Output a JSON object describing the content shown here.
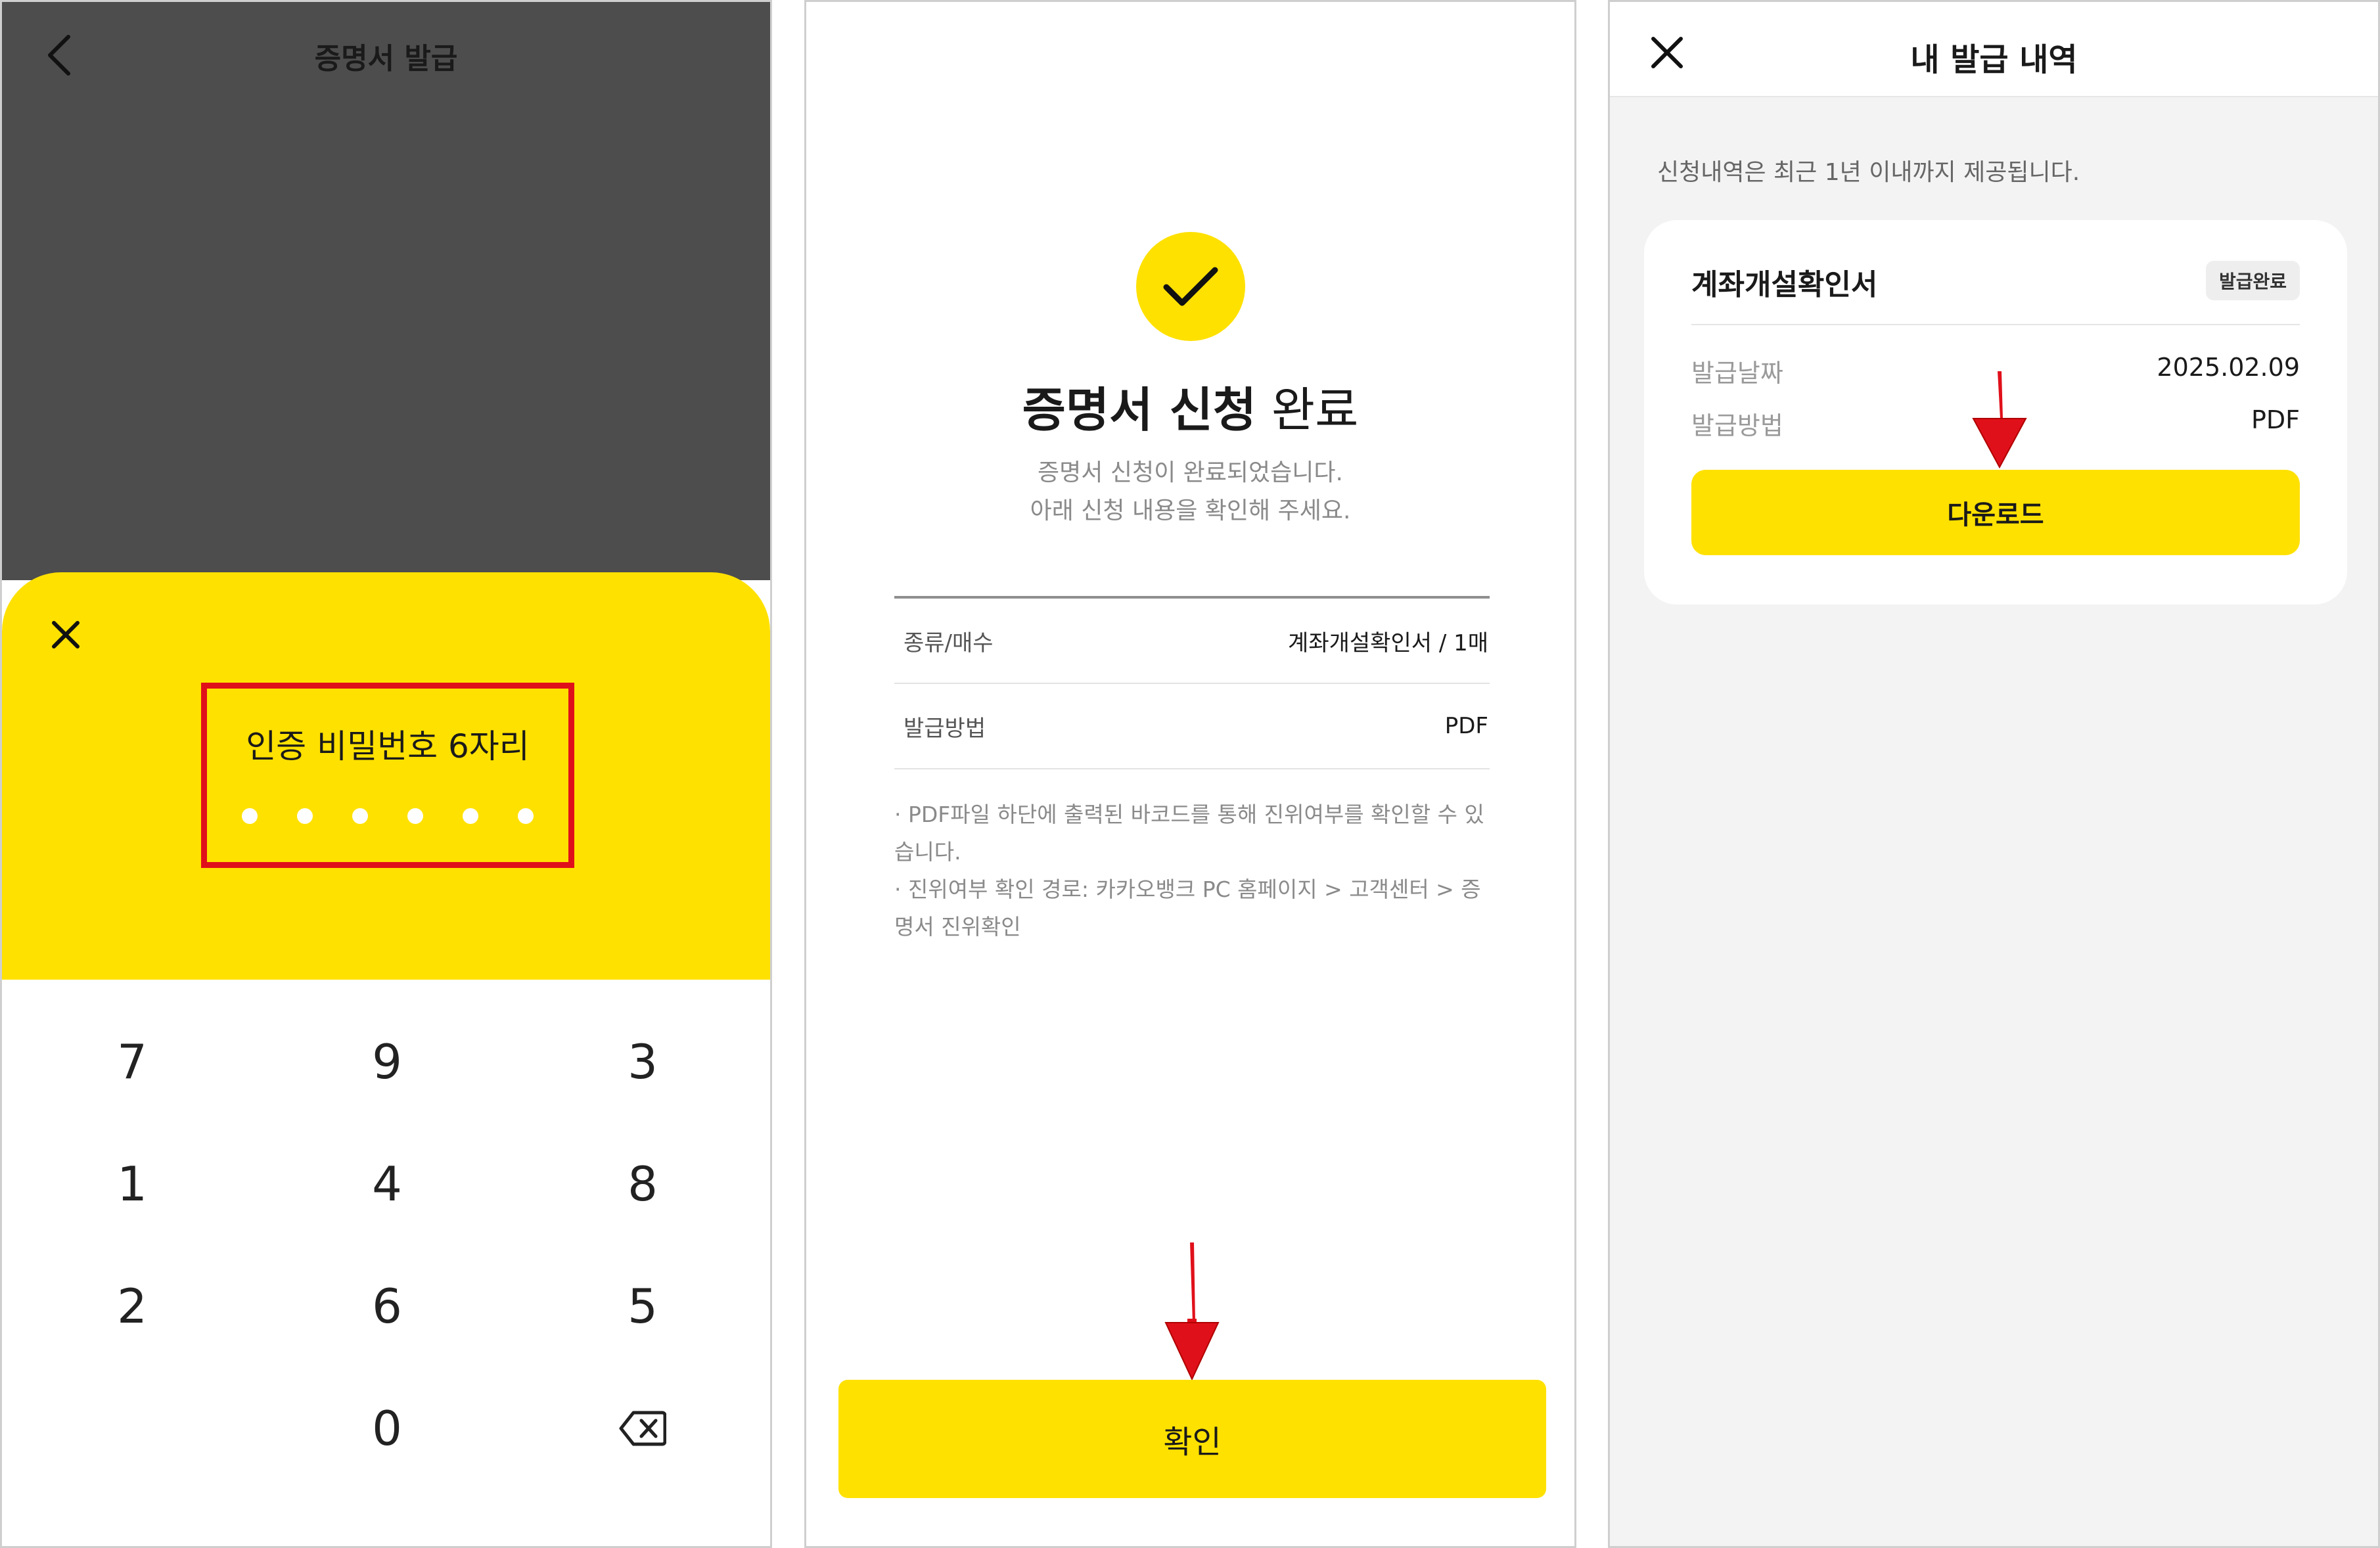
{
  "colors": {
    "accent": "#ffe100",
    "highlight": "#e0101a",
    "dim_overlay": "#4d4d4d"
  },
  "panel1": {
    "title": "증명서 발급",
    "pin": {
      "label": "인증 비밀번호 6자리",
      "dot_count": 6
    },
    "keypad": {
      "rows": [
        [
          "7",
          "9",
          "3"
        ],
        [
          "1",
          "4",
          "8"
        ],
        [
          "2",
          "6",
          "5"
        ],
        [
          "",
          "0",
          "backspace-icon"
        ]
      ]
    },
    "icons": {
      "back": "chevron-left-icon",
      "close": "close-icon",
      "backspace": "backspace-icon"
    }
  },
  "panel2": {
    "title_bold": "증명서 신청",
    "title_light": "완료",
    "desc_line1": "증명서 신청이 완료되었습니다.",
    "desc_line2": "아래 신청 내용을 확인해 주세요.",
    "rows": [
      {
        "label": "종류/매수",
        "value": "계좌개설확인서 / 1매"
      },
      {
        "label": "발급방법",
        "value": "PDF"
      }
    ],
    "note1": "· PDF파일 하단에 출력된 바코드를 통해 진위여부를 확인할 수 있습니다.",
    "note2": "· 진위여부 확인 경로: 카카오뱅크 PC 홈페이지 > 고객센터 > 증명서 진위확인",
    "confirm_label": "확인",
    "icons": {
      "success": "check-icon",
      "pointer": "red-arrow-down-icon"
    }
  },
  "panel3": {
    "title": "내 발급 내역",
    "notice": "신청내역은 최근 1년 이내까지 제공됩니다.",
    "card": {
      "title": "계좌개설확인서",
      "badge": "발급완료",
      "date_label": "발급날짜",
      "date_value": "2025.02.09",
      "method_label": "발급방법",
      "method_value": "PDF",
      "download_label": "다운로드"
    },
    "icons": {
      "close": "close-icon",
      "pointer": "red-arrow-down-icon"
    }
  }
}
